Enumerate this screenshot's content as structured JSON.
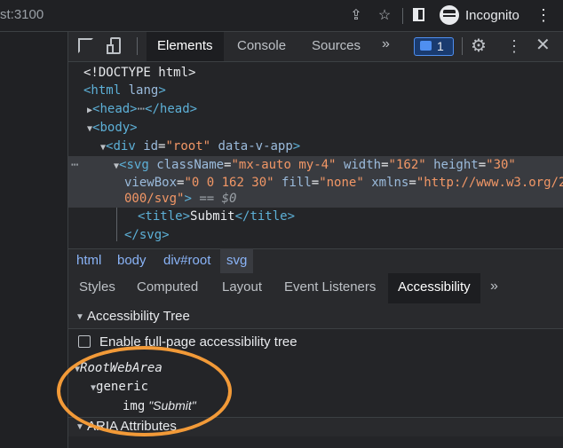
{
  "browser": {
    "url_fragment": "st:3100",
    "incognito_label": "Incognito"
  },
  "devtools": {
    "tabs": [
      "Elements",
      "Console",
      "Sources"
    ],
    "issues_count": "1",
    "dom": {
      "doctype": "<!DOCTYPE html>",
      "html_open": "<html",
      "html_attr": "lang",
      "html_close": ">",
      "head_open": "<head>",
      "head_dots": "⋯",
      "head_close": "</head>",
      "body": "<body>",
      "div_open": "<div",
      "div_attr1": "id",
      "div_val1": "\"root\"",
      "div_attr2": "data-v-app",
      "div_close": ">",
      "svg_line1_open": "<svg",
      "svg_classname_attr": "className",
      "svg_classname_val": "\"mx-auto my-4\"",
      "svg_width_attr": "width",
      "svg_width_val": "\"162\"",
      "svg_height_attr": "height",
      "svg_height_val": "\"30\"",
      "svg_viewbox_attr": "viewBox",
      "svg_viewbox_val": "\"0 0 162 30\"",
      "svg_fill_attr": "fill",
      "svg_fill_val": "\"none\"",
      "svg_xmlns_attr": "xmlns",
      "svg_xmlns_val_part1": "\"http://www.w3.org/2",
      "svg_xmlns_val_part2": "000/svg\"",
      "svg_close": ">",
      "selected_marker": "== $0",
      "title_open": "<title>",
      "title_text": "Submit",
      "title_close": "</title>",
      "svg_end": "</svg>",
      "row_dots": "⋯"
    },
    "breadcrumbs": [
      "html",
      "body",
      "div#root",
      "svg"
    ],
    "subtabs": [
      "Styles",
      "Computed",
      "Layout",
      "Event Listeners",
      "Accessibility"
    ],
    "accessibility": {
      "tree_header": "Accessibility Tree",
      "enable_label": "Enable full-page accessibility tree",
      "root_node": "RootWebArea",
      "generic_node": "generic",
      "img_role": "img",
      "img_name": "\"Submit\"",
      "aria_header": "ARIA Attributes"
    }
  },
  "colors": {
    "annotation_ring": "#f29a38",
    "tag": "#5db0d7",
    "attr_value": "#f29766",
    "link": "#8ab4f8"
  }
}
